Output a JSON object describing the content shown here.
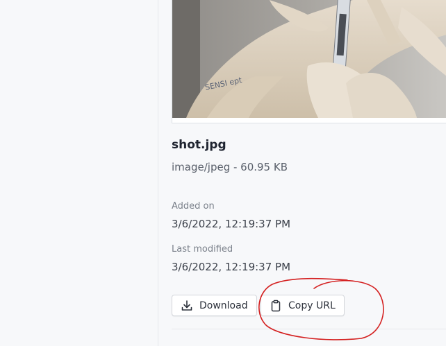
{
  "file": {
    "name": "shot.jpg",
    "meta": "image/jpeg - 60.95 KB",
    "preview_alt": "shot.jpg preview"
  },
  "details": {
    "added_label": "Added on",
    "added_value": "3/6/2022, 12:19:37 PM",
    "modified_label": "Last modified",
    "modified_value": "3/6/2022, 12:19:37 PM"
  },
  "actions": {
    "download_label": "Download",
    "copy_url_label": "Copy URL"
  },
  "colors": {
    "annotation": "#d42020",
    "background": "#f7f8fa"
  }
}
